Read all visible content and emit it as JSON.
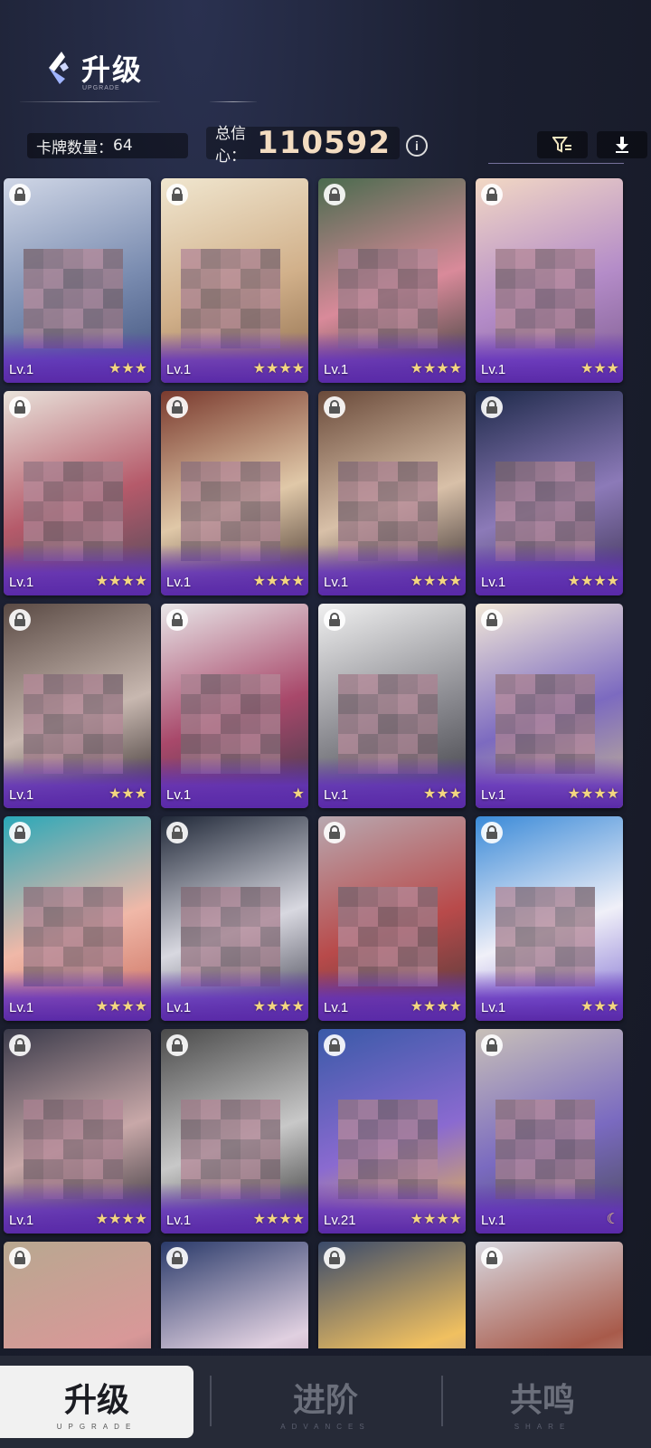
{
  "header": {
    "title": "升级",
    "title_sub": "UPGRADE",
    "card_count_label": "卡牌数量：",
    "card_count_value": "64",
    "trust_label": "总信心：",
    "trust_value": "110592",
    "info_icon": "info-icon",
    "filter_icon": "filter-icon",
    "download_icon": "download-icon"
  },
  "colors": {
    "accent_purple": "#5a2aa8",
    "star_gold": "#f3d680",
    "trust_text": "#f3dcc0"
  },
  "cards": [
    {
      "level": "Lv.1",
      "stars": "★★★",
      "icon": "lock-icon"
    },
    {
      "level": "Lv.1",
      "stars": "★★★★",
      "icon": "lock-icon"
    },
    {
      "level": "Lv.1",
      "stars": "★★★★",
      "icon": "lock-icon"
    },
    {
      "level": "Lv.1",
      "stars": "★★★",
      "icon": "lock-icon"
    },
    {
      "level": "Lv.1",
      "stars": "★★★★",
      "icon": "lock-icon"
    },
    {
      "level": "Lv.1",
      "stars": "★★★★",
      "icon": "lock-icon"
    },
    {
      "level": "Lv.1",
      "stars": "★★★★",
      "icon": "lock-icon"
    },
    {
      "level": "Lv.1",
      "stars": "★★★★",
      "icon": "lock-icon"
    },
    {
      "level": "Lv.1",
      "stars": "★★★",
      "icon": "lock-icon"
    },
    {
      "level": "Lv.1",
      "stars": "★",
      "icon": "lock-icon"
    },
    {
      "level": "Lv.1",
      "stars": "★★★",
      "icon": "lock-icon"
    },
    {
      "level": "Lv.1",
      "stars": "★★★★",
      "icon": "lock-icon"
    },
    {
      "level": "Lv.1",
      "stars": "★★★★",
      "icon": "lock-icon"
    },
    {
      "level": "Lv.1",
      "stars": "★★★★",
      "icon": "lock-icon"
    },
    {
      "level": "Lv.1",
      "stars": "★★★★",
      "icon": "lock-icon"
    },
    {
      "level": "Lv.1",
      "stars": "★★★",
      "icon": "lock-icon"
    },
    {
      "level": "Lv.1",
      "stars": "★★★★",
      "icon": "lock-icon"
    },
    {
      "level": "Lv.1",
      "stars": "★★★★",
      "icon": "lock-icon"
    },
    {
      "level": "Lv.21",
      "stars": "★★★★",
      "icon": "lock-icon"
    },
    {
      "level": "Lv.1",
      "stars": "☾",
      "icon": "lock-icon"
    },
    {
      "level": "",
      "stars": "",
      "icon": "lock-icon"
    },
    {
      "level": "",
      "stars": "",
      "icon": "lock-icon"
    },
    {
      "level": "",
      "stars": "",
      "icon": "lock-icon"
    },
    {
      "level": "",
      "stars": "",
      "icon": "lock-icon"
    }
  ],
  "bottom_nav": [
    {
      "label": "升级",
      "sub": "UPGRADE",
      "active": true
    },
    {
      "label": "进阶",
      "sub": "ADVANCES",
      "active": false
    },
    {
      "label": "共鸣",
      "sub": "SHARE",
      "active": false
    }
  ]
}
